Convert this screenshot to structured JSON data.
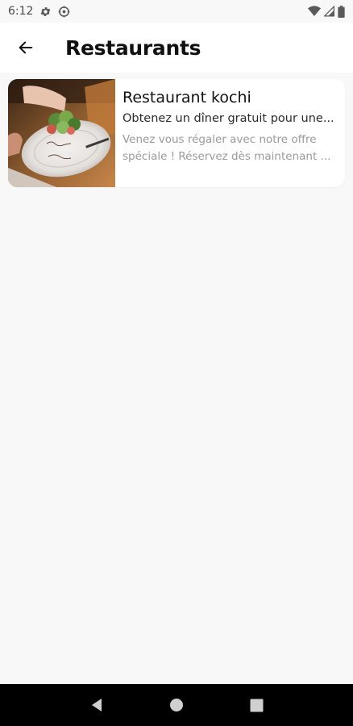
{
  "status_bar": {
    "time": "6:12",
    "icons": [
      "settings-gear-icon",
      "settings-alt-icon",
      "wifi-icon",
      "cell-signal-icon",
      "battery-icon"
    ]
  },
  "app_bar": {
    "back_icon": "arrow-left-icon",
    "title": "Restaurants"
  },
  "restaurants": [
    {
      "title": "Restaurant kochi",
      "subtitle": "Obtenez un dîner gratuit pour une...",
      "description": "Venez vous régaler avec notre offre spéciale ! Réservez dès maintenant ..."
    }
  ],
  "nav_bar": {
    "buttons": [
      "back-triangle-icon",
      "home-circle-icon",
      "recents-square-icon"
    ]
  },
  "colors": {
    "background": "#f8f8f8",
    "card": "#ffffff",
    "title": "#111111",
    "muted": "#9a9a9a",
    "nav": "#000000"
  }
}
